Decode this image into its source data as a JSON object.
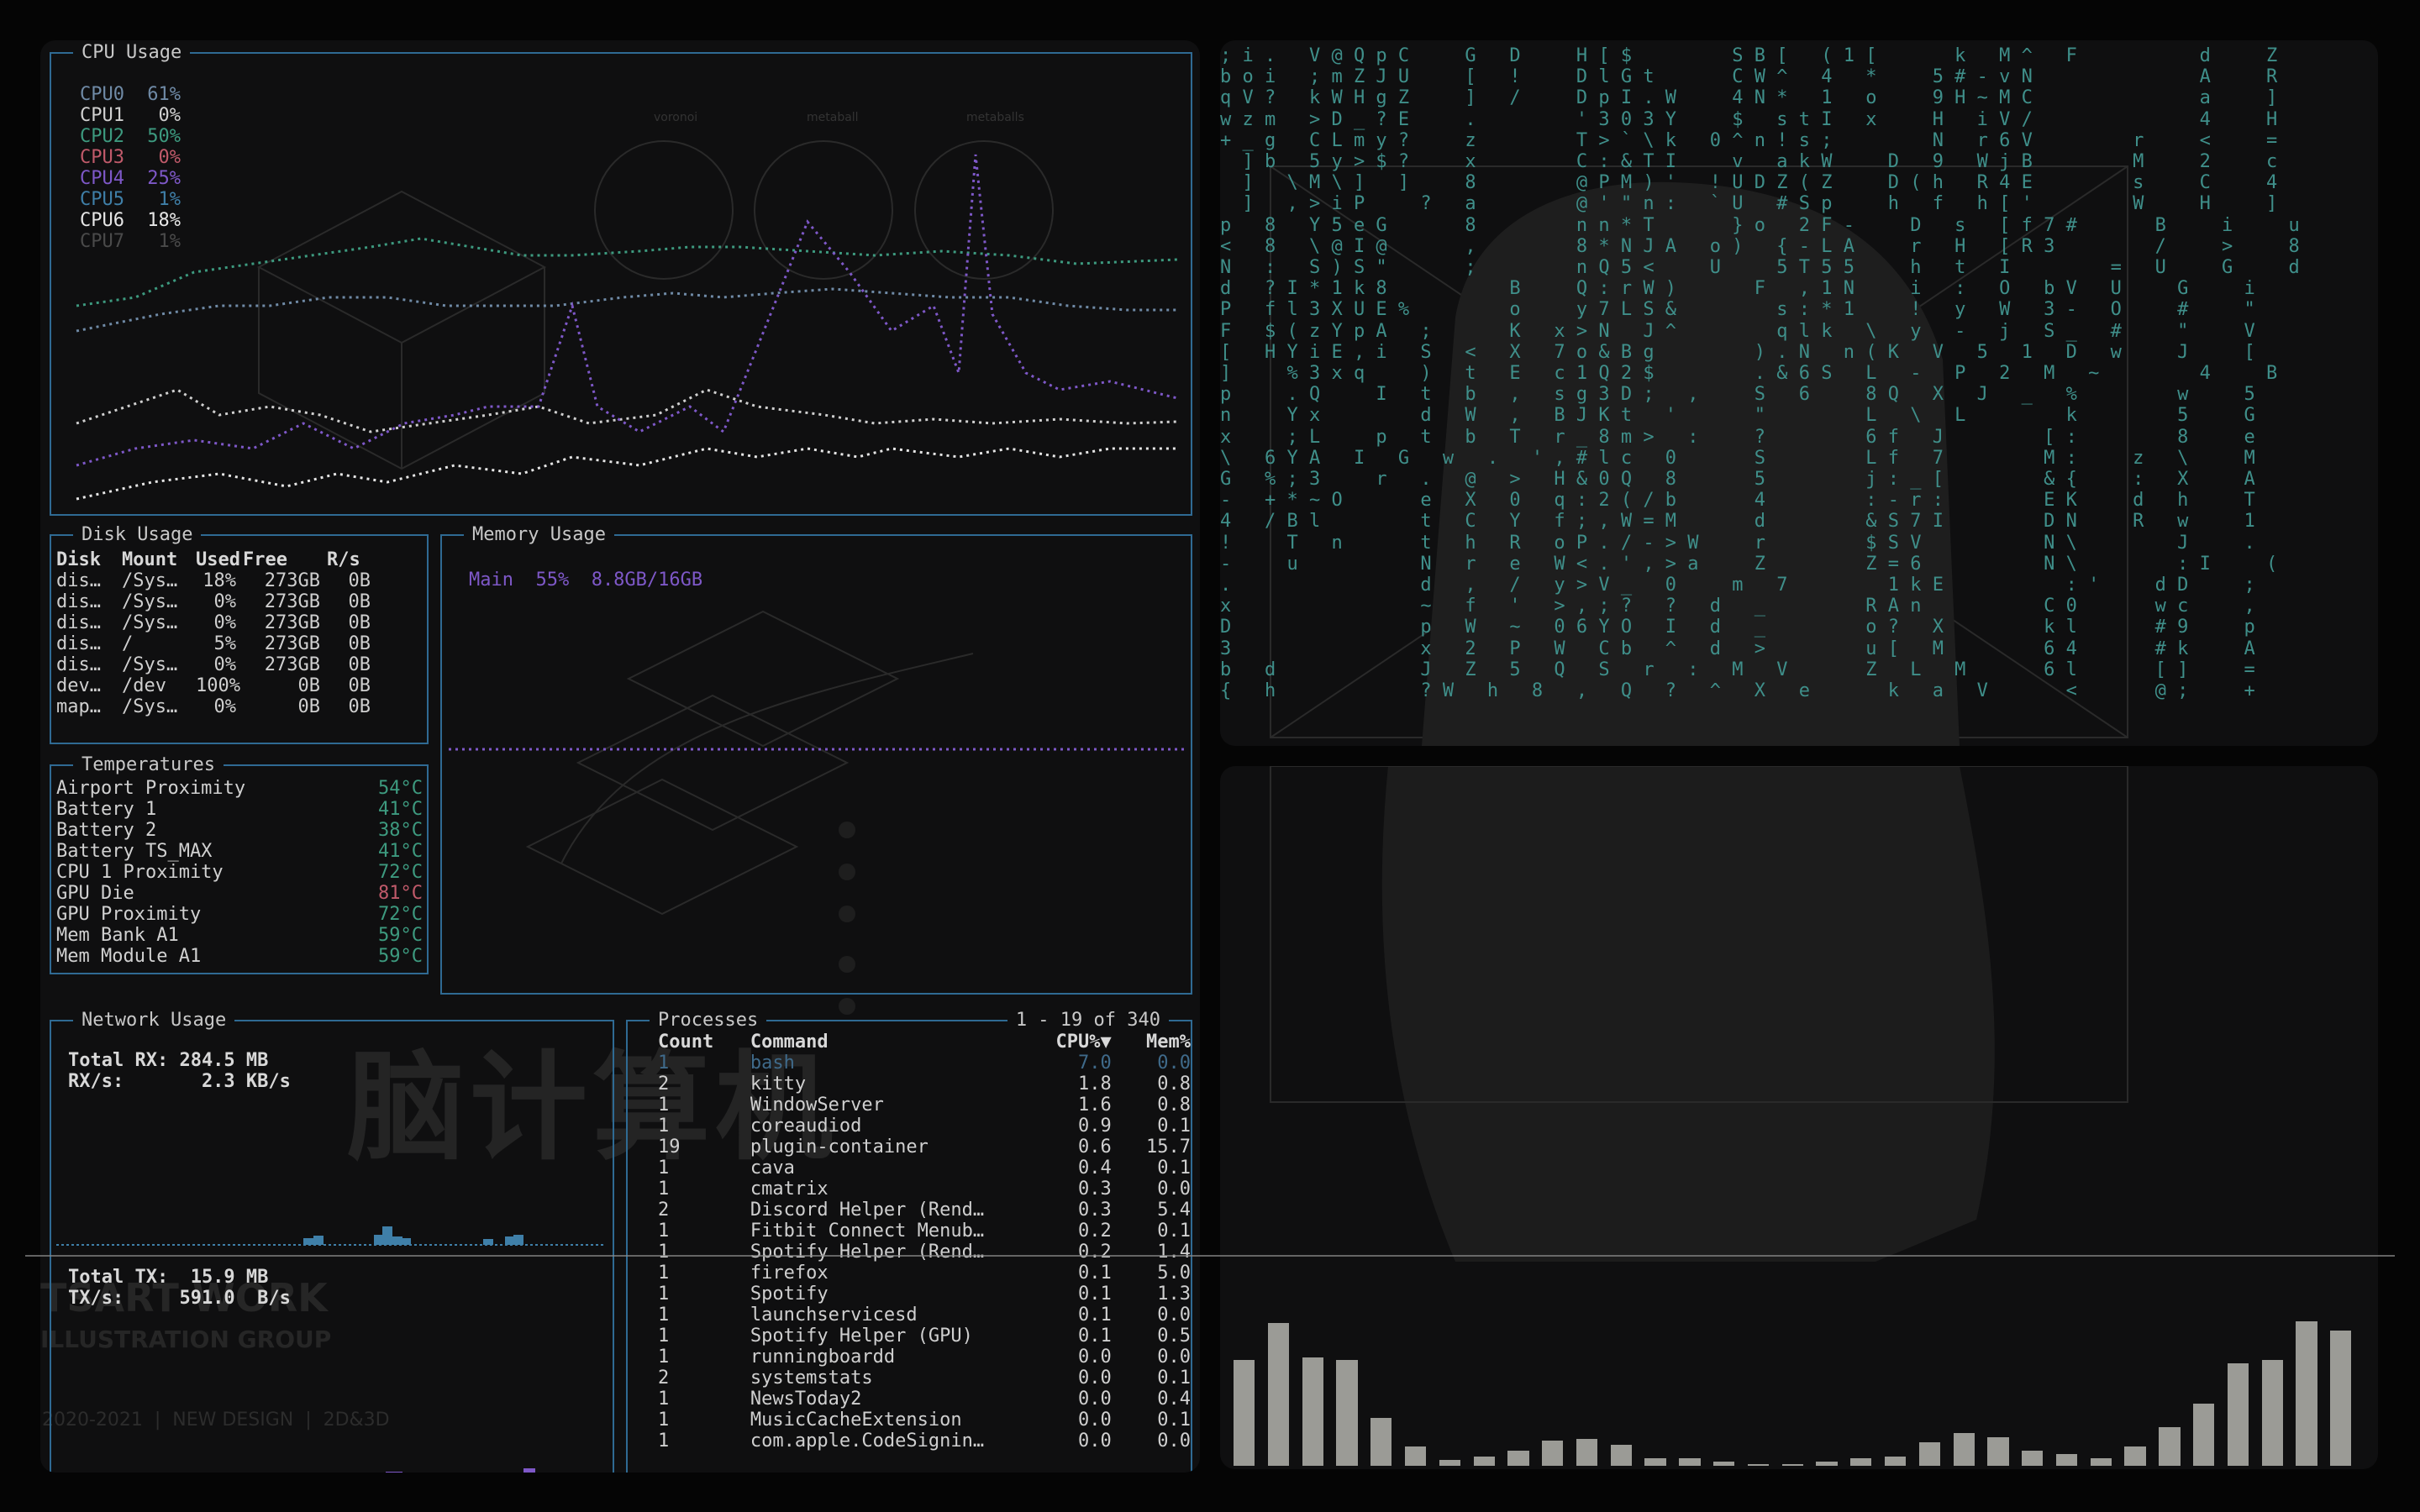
{
  "cpu": {
    "title": "CPU Usage",
    "cores": [
      {
        "label": "CPU0",
        "value": "61%",
        "color": "#6f8aa6"
      },
      {
        "label": "CPU1",
        "value": "0%",
        "color": "#d0d0d0"
      },
      {
        "label": "CPU2",
        "value": "50%",
        "color": "#3d9a7f"
      },
      {
        "label": "CPU3",
        "value": "0%",
        "color": "#c05a6a"
      },
      {
        "label": "CPU4",
        "value": "25%",
        "color": "#7e58c8"
      },
      {
        "label": "CPU5",
        "value": "1%",
        "color": "#3f7fa8"
      },
      {
        "label": "CPU6",
        "value": "18%",
        "color": "#e6e6e6"
      },
      {
        "label": "CPU7",
        "value": "1%",
        "color": "#4a4a4a"
      }
    ]
  },
  "disk": {
    "title": "Disk Usage",
    "headers": [
      "Disk",
      "Mount",
      "Used",
      "Free",
      "R/s"
    ],
    "rows": [
      [
        "dis…",
        "/Sys…",
        "18%",
        "273GB",
        "0B"
      ],
      [
        "dis…",
        "/Sys…",
        "0%",
        "273GB",
        "0B"
      ],
      [
        "dis…",
        "/Sys…",
        "0%",
        "273GB",
        "0B"
      ],
      [
        "dis…",
        "/",
        "5%",
        "273GB",
        "0B"
      ],
      [
        "dis…",
        "/Sys…",
        "0%",
        "273GB",
        "0B"
      ],
      [
        "dev…",
        "/dev",
        "100%",
        "0B",
        "0B"
      ],
      [
        "map…",
        "/Sys…",
        "0%",
        "0B",
        "0B"
      ]
    ]
  },
  "memory": {
    "title": "Memory Usage",
    "line": "Main  55%  8.8GB/16GB",
    "fraction": 0.55
  },
  "temps": {
    "title": "Temperatures",
    "rows": [
      {
        "name": "Airport Proximity",
        "value": "54°C",
        "color": "#3d9a7f"
      },
      {
        "name": "Battery 1",
        "value": "41°C",
        "color": "#3d9a7f"
      },
      {
        "name": "Battery 2",
        "value": "38°C",
        "color": "#3d9a7f"
      },
      {
        "name": "Battery TS_MAX",
        "value": "41°C",
        "color": "#3d9a7f"
      },
      {
        "name": "CPU 1 Proximity",
        "value": "72°C",
        "color": "#3d9a7f"
      },
      {
        "name": "GPU Die",
        "value": "81°C",
        "color": "#c05a6a"
      },
      {
        "name": "GPU Proximity",
        "value": "72°C",
        "color": "#3d9a7f"
      },
      {
        "name": "Mem Bank A1",
        "value": "59°C",
        "color": "#3d9a7f"
      },
      {
        "name": "Mem Module A1",
        "value": "59°C",
        "color": "#3d9a7f"
      }
    ]
  },
  "network": {
    "title": "Network Usage",
    "rx_total": "Total RX: 284.5 MB",
    "rx_rate": "RX/s:       2.3 KB/s",
    "tx_total": "Total TX:  15.9 MB",
    "tx_rate": "TX/s:     591.0  B/s"
  },
  "processes": {
    "title": "Processes",
    "range": "1 - 19 of 340",
    "headers": [
      "Count",
      "Command",
      "CPU%▼",
      "Mem%"
    ],
    "rows": [
      [
        "1",
        "bash",
        "7.0",
        "0.0"
      ],
      [
        "2",
        "kitty",
        "1.8",
        "0.8"
      ],
      [
        "1",
        "WindowServer",
        "1.6",
        "0.8"
      ],
      [
        "1",
        "coreaudiod",
        "0.9",
        "0.1"
      ],
      [
        "19",
        "plugin-container",
        "0.6",
        "15.7"
      ],
      [
        "1",
        "cava",
        "0.4",
        "0.1"
      ],
      [
        "1",
        "cmatrix",
        "0.3",
        "0.0"
      ],
      [
        "2",
        "Discord Helper (Rend…",
        "0.3",
        "5.4"
      ],
      [
        "1",
        "Fitbit Connect Menub…",
        "0.2",
        "0.1"
      ],
      [
        "1",
        "Spotify Helper (Rend…",
        "0.2",
        "1.4"
      ],
      [
        "1",
        "firefox",
        "0.1",
        "5.0"
      ],
      [
        "1",
        "Spotify",
        "0.1",
        "1.3"
      ],
      [
        "1",
        "launchservicesd",
        "0.1",
        "0.0"
      ],
      [
        "1",
        "Spotify Helper (GPU)",
        "0.1",
        "0.5"
      ],
      [
        "1",
        "runningboardd",
        "0.0",
        "0.0"
      ],
      [
        "2",
        "systemstats",
        "0.0",
        "0.1"
      ],
      [
        "1",
        "NewsToday2",
        "0.0",
        "0.4"
      ],
      [
        "1",
        "MusicCacheExtension",
        "0.0",
        "0.1"
      ],
      [
        "1",
        "com.apple.CodeSignin…",
        "0.0",
        "0.0"
      ]
    ]
  },
  "wallpaper": {
    "big_text": "脑计算机",
    "studio": "TSART WORK",
    "group": "ILLUSTRATION GROUP",
    "footer": "2020-2021  |  NEW DESIGN  |  2D&3D",
    "labels": [
      "voronoi",
      "metaball",
      "metaballs"
    ]
  },
  "matrix_lines": [
    "; i .   V @ Q p C     G   D     H [ $         S B [   ( 1 [       k   M ^   F           d     Z",
    "b o i   ; m Z J U     [   !     D l G t       C W ^   4   *     5 # - v N               A     R",
    "q V ?   k W H g Z     ]   /     D p I . W     4 N *   1   o     9 H ~ M C               a     ]",
    "w z m   > D _ ? E     .         ' 3 0 3 Y     $   s t I   x     H   i V /               4     H",
    "+ _ g   C L m y ?     z         T > ` \\ k   0 ^ n ! s ;         N   r 6 V         r     <     =",
    "  ] b   5 y > $ ?     x         C : & T I     v   a k W     D   9   W j B         M     2     c",
    "  ]   \\ M \\ ]   ]     8         @ P M ) '   ! U D Z ( Z     D ( h   R 4 E         s     C     4",
    "  ]   , > i P     ?   a         @ ' \" n :   ` U   # S p     h   f   h [ '         W     H     ]",
    "p   8   Y 5 e G       8         n n * T       } o   2 F -     D   s   [ f 7 #       B     i     u",
    "<   8   \\ @ I @       ,         8 * N J A   o )   { - L A     r   H   [ R 3         /     >     8",
    "N   :   S ) S \"       ;         n Q 5 <     U     5 T 5 5     h   t   I         =   U     G     d",
    "d   ? I * 1 k 8           B     Q : r W )       F   , 1 N     i   :   O   b V   U     G     i",
    "P   f l 3 X U E %         o     y 7 L S &         s : * 1     !   y   W   3 -   O     #     \"",
    "F   $ ( z Y p A   ;       K   x > N   J ^         q l k   \\   y   -   j   S _   #     \"     V",
    "[   H Y i E , i   S   <   X   7 o & B g         ) . N   n ( K   V   5   1   D   w     J     [",
    "]     % 3 x q     )   t   E   c 1 Q 2 $         . & 6 S   L   -   P   2   M   ~         4     B",
    "p     . Q     I   t   b   ,   s g 3 D ;   ,     S   6     8 Q   X   J   _   %         w     5",
    "n     Y x         d   W   ,   B J K t   '       \"         L   \\   L         k         5     G",
    "x     ; L     p   t   b   T   r _ 8 m >   :     ?         6 f   J         [ :         8     e",
    "\\   6 Y A   I   G   w   .   ' , # l c   0       S         L f   7         M :     z   \\     M",
    "G   % ; 3     r   .   @   >   H & 0 Q   8       5         j : _ [         & {     :   X     A",
    "-   + * ~ O       e   X   0   q : 2 ( / b       4         : - r :         E K     d   h     T",
    "4   / B l         t   C   Y   f ; , W = M       d         & S 7 I         D N     R   w     1",
    "!     T   n       t   h   R   o P . / - > W     r         $ S V           N \\         J     .",
    "-     u           N   r   e   W < . ' , > a     Z         Z = 6           N \\         : I     (",
    ".                 d   ,   /   y > V _   0     m   7         1 k E           : '     d D     ;",
    "x                 ~   f   '   > , ; ?   ?   d   _         R A n           C 0       w c     ,",
    "D                 p   W   ~   0 6 Y O   I   d   _         o ?   X         k l       # 9     p",
    "3                 x   2   P   W   C b   ^   d   >         u [   M         6 4       # k     A",
    "b   d             J   Z   5   Q   S   r   :   M   V       Z   L   M       6 l       [ ]     =",
    "{   h             ? W   h   8   ,   Q   ?   ^   X   e       k   a   V       <       @ ;     +"
  ],
  "visualizer": [
    0.55,
    0.74,
    0.56,
    0.55,
    0.25,
    0.1,
    0.03,
    0.05,
    0.08,
    0.13,
    0.14,
    0.11,
    0.04,
    0.04,
    0.02,
    0.01,
    0.01,
    0.02,
    0.04,
    0.05,
    0.12,
    0.17,
    0.15,
    0.08,
    0.06,
    0.04,
    0.1,
    0.2,
    0.32,
    0.53,
    0.55,
    0.75,
    0.7
  ]
}
